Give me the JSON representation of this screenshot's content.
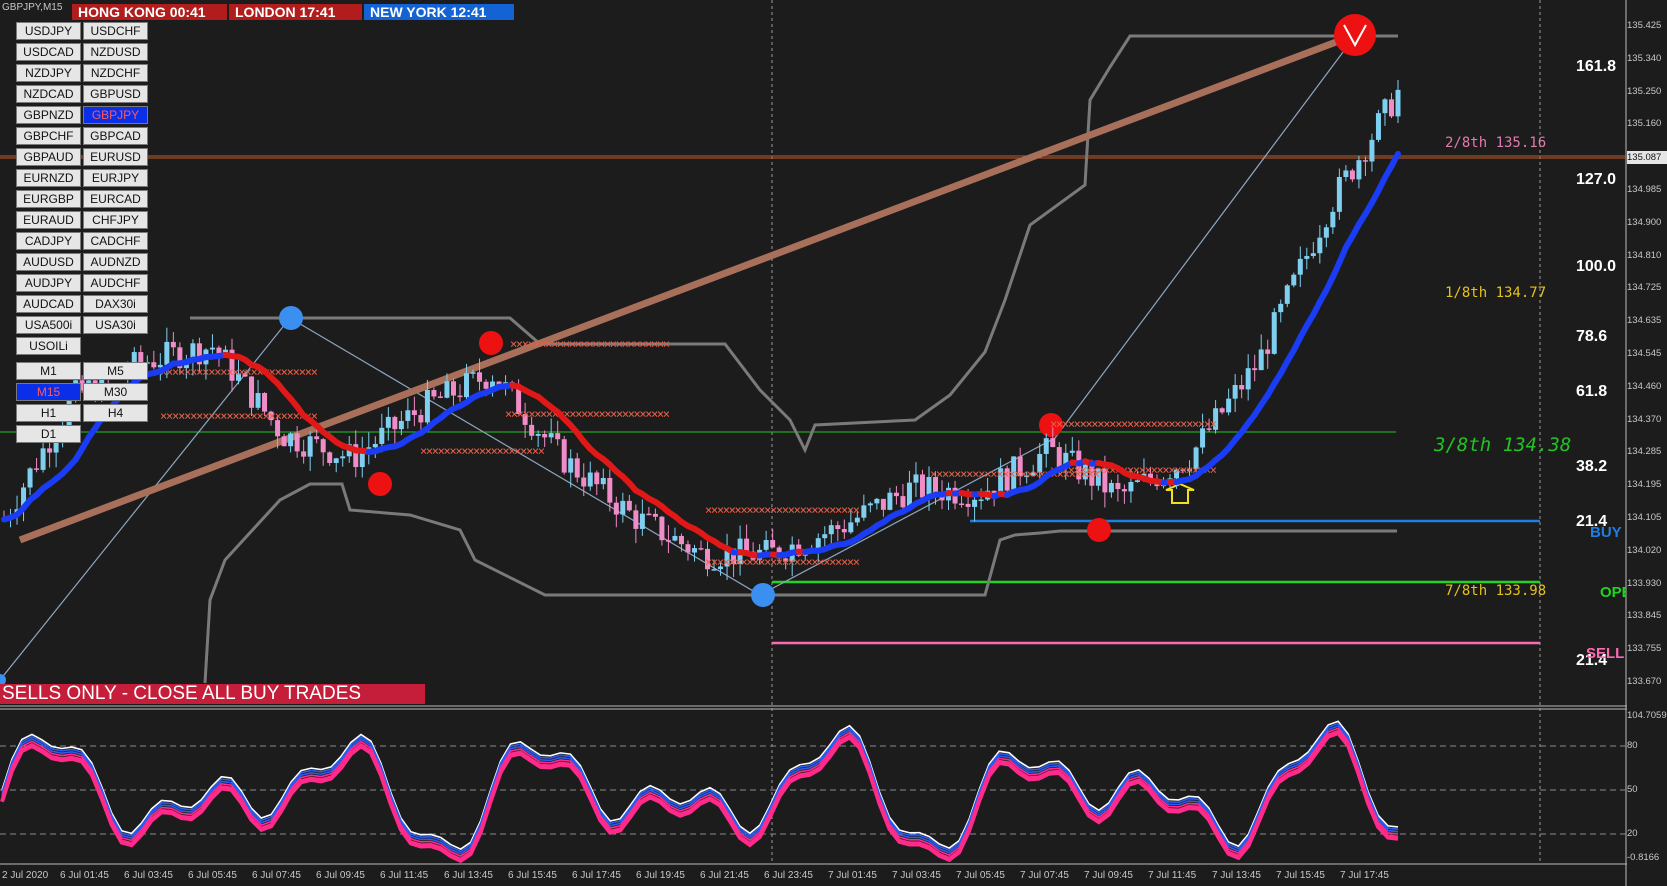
{
  "chart_title": "GBPJPY,M15",
  "clocks": [
    {
      "label": "HONG KONG 00:41",
      "bg": "#b11d1d"
    },
    {
      "label": "LONDON   17:41",
      "bg": "#b11d1d"
    },
    {
      "label": "NEW YORK  12:41",
      "bg": "#1463d4"
    }
  ],
  "symbol_buttons": [
    [
      "USDJPY",
      "USDCHF"
    ],
    [
      "USDCAD",
      "NZDUSD"
    ],
    [
      "NZDJPY",
      "NZDCHF"
    ],
    [
      "NZDCAD",
      "GBPUSD"
    ],
    [
      "GBPNZD",
      "GBPJPY"
    ],
    [
      "GBPCHF",
      "GBPCAD"
    ],
    [
      "GBPAUD",
      "EURUSD"
    ],
    [
      "EURNZD",
      "EURJPY"
    ],
    [
      "EURGBP",
      "EURCAD"
    ],
    [
      "EURAUD",
      "CHFJPY"
    ],
    [
      "CADJPY",
      "CADCHF"
    ],
    [
      "AUDUSD",
      "AUDNZD"
    ],
    [
      "AUDJPY",
      "AUDCHF"
    ],
    [
      "AUDCAD",
      "DAX30i"
    ],
    [
      "USA500i",
      "USA30i"
    ],
    [
      "USOILi"
    ]
  ],
  "active_symbol": "GBPJPY",
  "timeframe_buttons": [
    [
      "M1",
      "M5"
    ],
    [
      "M15",
      "M30"
    ],
    [
      "H1",
      "H4"
    ],
    [
      "D1"
    ]
  ],
  "active_timeframe": "M15",
  "banner_text": "SELLS ONLY - CLOSE ALL BUY TRADES",
  "price_axis": [
    "135.425",
    "135.340",
    "135.250",
    "135.160",
    "135.087",
    "134.985",
    "134.900",
    "134.810",
    "134.725",
    "134.635",
    "134.545",
    "134.460",
    "134.370",
    "134.285",
    "134.195",
    "134.105",
    "134.020",
    "133.930",
    "133.845",
    "133.755",
    "133.670"
  ],
  "current_price": "135.087",
  "fib_labels": [
    "161.8",
    "127.0",
    "100.0",
    "78.6",
    "61.8",
    "38.2",
    "21.4",
    "21.4"
  ],
  "murrey_levels": [
    {
      "label": "2/8th  135.16",
      "color": "#e07ab0"
    },
    {
      "label": "1/8th  134.77",
      "color": "#e6c21a"
    },
    {
      "label": "3/8th  134.38",
      "color": "#22c322"
    },
    {
      "label": "7/8th  133.98",
      "color": "#e6c21a"
    }
  ],
  "side_labels": [
    {
      "text": "BUY",
      "color": "#1f7fe0"
    },
    {
      "text": "OPEN",
      "color": "#22d322"
    },
    {
      "text": "SELL",
      "color": "#ff69b4"
    }
  ],
  "osc_axis": [
    "104.7059",
    "80",
    "50",
    "20",
    "-0.8166"
  ],
  "time_axis": [
    "2 Jul 2020",
    "6 Jul 01:45",
    "6 Jul 03:45",
    "6 Jul 05:45",
    "6 Jul 07:45",
    "6 Jul 09:45",
    "6 Jul 11:45",
    "6 Jul 13:45",
    "6 Jul 15:45",
    "6 Jul 17:45",
    "6 Jul 19:45",
    "6 Jul 21:45",
    "6 Jul 23:45",
    "7 Jul 01:45",
    "7 Jul 03:45",
    "7 Jul 05:45",
    "7 Jul 07:45",
    "7 Jul 09:45",
    "7 Jul 11:45",
    "7 Jul 13:45",
    "7 Jul 15:45",
    "7 Jul 17:45"
  ],
  "colors": {
    "background": "#1c1c1c",
    "bull_candle": "#7fd0f0",
    "bear_candle": "#f08cc8",
    "ma_up": "#1b3cf5",
    "ma_down": "#e01818",
    "trendline": "#a8705a",
    "channel": "#8a8a8a",
    "osc_pink": "#ff2a8a",
    "osc_blue": "#2a5cf0"
  },
  "chart_data": {
    "type": "candlestick",
    "title": "GBPJPY,M15",
    "ylim": [
      133.67,
      135.425
    ],
    "x": [
      "6 Jul 01:45",
      "6 Jul 03:45",
      "6 Jul 05:45",
      "6 Jul 07:45",
      "6 Jul 09:45",
      "6 Jul 11:45",
      "6 Jul 13:45",
      "6 Jul 15:45",
      "6 Jul 17:45",
      "6 Jul 19:45",
      "6 Jul 21:45",
      "6 Jul 23:45",
      "7 Jul 01:45",
      "7 Jul 03:45",
      "7 Jul 05:45",
      "7 Jul 07:45",
      "7 Jul 09:45",
      "7 Jul 11:45",
      "7 Jul 13:45",
      "7 Jul 15:45",
      "7 Jul 17:45"
    ],
    "series": [
      {
        "name": "close",
        "values": [
          134.14,
          134.46,
          134.55,
          134.59,
          134.36,
          134.3,
          134.43,
          134.52,
          134.3,
          134.15,
          134.05,
          134.05,
          134.12,
          134.22,
          134.21,
          134.32,
          134.2,
          134.3,
          134.55,
          134.95,
          135.25
        ]
      }
    ]
  }
}
